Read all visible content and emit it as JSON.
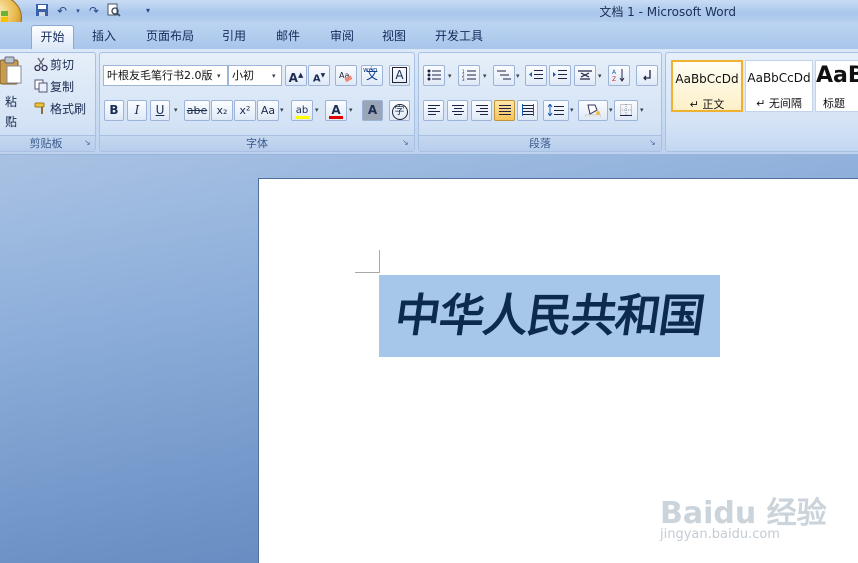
{
  "window": {
    "title": "文档 1 - Microsoft Word"
  },
  "tabs": [
    {
      "label": "开始"
    },
    {
      "label": "插入"
    },
    {
      "label": "页面布局"
    },
    {
      "label": "引用"
    },
    {
      "label": "邮件"
    },
    {
      "label": "审阅"
    },
    {
      "label": "视图"
    },
    {
      "label": "开发工具"
    }
  ],
  "clipboard": {
    "paste": "粘贴",
    "cut": "剪切",
    "copy": "复制",
    "format_painter": "格式刷",
    "group_label": "剪贴板"
  },
  "font": {
    "name": "叶根友毛笔行书2.0版",
    "size": "小初",
    "grow": "A",
    "shrink": "A",
    "change_case": "Aa",
    "bold": "B",
    "italic": "I",
    "underline": "U",
    "strike": "abe",
    "subscript": "x₂",
    "superscript": "x²",
    "highlight": "ab",
    "font_color": "A",
    "char_shading": "A",
    "enclose": "字",
    "phonetic": "wén",
    "char_border": "A",
    "group_label": "字体"
  },
  "paragraph": {
    "group_label": "段落"
  },
  "styles": [
    {
      "sample": "AaBbCcDd",
      "name": "↵ 正文"
    },
    {
      "sample": "AaBbCcDd",
      "name": "↵ 无间隔"
    },
    {
      "sample": "AaB",
      "name": "标题"
    }
  ],
  "document": {
    "text": "中华人民共和国"
  },
  "watermark": {
    "brand": "Baidu 经验",
    "url": "jingyan.baidu.com"
  },
  "colors": {
    "highlight": "#ffff00",
    "font_color": "#e00000",
    "selection": "#a7c7ea"
  }
}
